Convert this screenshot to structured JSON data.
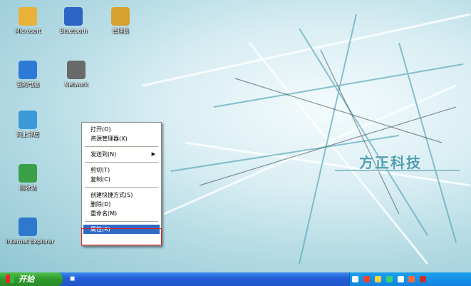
{
  "desktop": {
    "icons": [
      {
        "label": "Microsoft",
        "color": "#e8b23a"
      },
      {
        "label": "Bluetooth",
        "color": "#2e63c8"
      },
      {
        "label": "管理员",
        "color": "#d6a12e"
      },
      {
        "label": "我的电脑",
        "color": "#2d7ad6"
      },
      {
        "label": "Network",
        "color": "#6a6a6a"
      },
      {
        "label": "网上邻居",
        "color": "#3a9ad8"
      },
      {
        "label": "回收站",
        "color": "#3aa048"
      },
      {
        "label": "Internet Explorer",
        "color": "#2f78d0"
      }
    ],
    "logo_text": "方正科技"
  },
  "context_menu": {
    "items": [
      {
        "label": "打开(O)"
      },
      {
        "label": "资源管理器(X)"
      },
      {
        "label": "发送到(N)",
        "submenu": true
      },
      {
        "label": "剪切(T)"
      },
      {
        "label": "复制(C)"
      },
      {
        "label": "创建快捷方式(S)"
      },
      {
        "label": "删除(D)"
      },
      {
        "label": "重命名(M)"
      },
      {
        "label": "属性(R)",
        "selected": true
      }
    ]
  },
  "taskbar": {
    "start_label": "开始"
  }
}
